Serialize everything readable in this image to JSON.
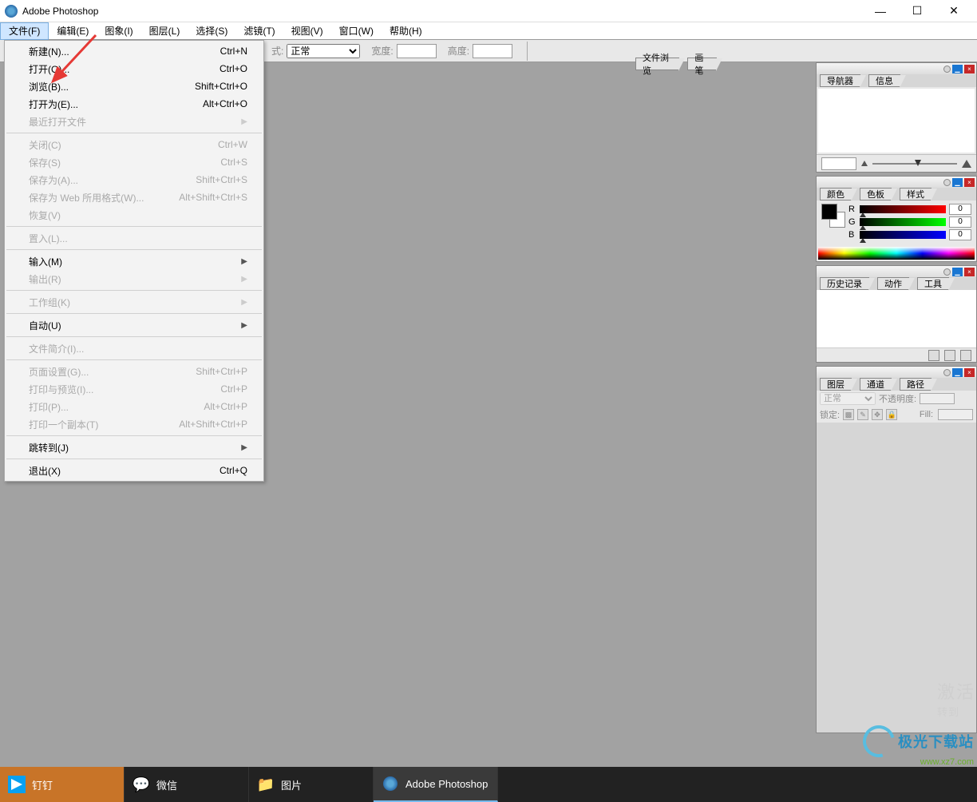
{
  "titlebar": {
    "title": "Adobe Photoshop"
  },
  "menubar": {
    "items": [
      "文件(F)",
      "编辑(E)",
      "图象(I)",
      "图层(L)",
      "选择(S)",
      "滤镜(T)",
      "视图(V)",
      "窗口(W)",
      "帮助(H)"
    ]
  },
  "optionsbar": {
    "mode_label": "式:",
    "mode_value": "正常",
    "width_label": "宽度:",
    "height_label": "高度:",
    "palette_tabs": [
      "文件浏览",
      "画笔"
    ]
  },
  "file_menu": {
    "items": [
      {
        "label": "新建(N)...",
        "shortcut": "Ctrl+N",
        "enabled": true
      },
      {
        "label": "打开(O)...",
        "shortcut": "Ctrl+O",
        "enabled": true
      },
      {
        "label": "浏览(B)...",
        "shortcut": "Shift+Ctrl+O",
        "enabled": true
      },
      {
        "label": "打开为(E)...",
        "shortcut": "Alt+Ctrl+O",
        "enabled": true
      },
      {
        "label": "最近打开文件",
        "shortcut": "",
        "enabled": false,
        "submenu": true
      },
      {
        "sep": true
      },
      {
        "label": "关闭(C)",
        "shortcut": "Ctrl+W",
        "enabled": false
      },
      {
        "label": "保存(S)",
        "shortcut": "Ctrl+S",
        "enabled": false
      },
      {
        "label": "保存为(A)...",
        "shortcut": "Shift+Ctrl+S",
        "enabled": false
      },
      {
        "label": "保存为 Web 所用格式(W)...",
        "shortcut": "Alt+Shift+Ctrl+S",
        "enabled": false
      },
      {
        "label": "恢复(V)",
        "shortcut": "",
        "enabled": false
      },
      {
        "sep": true
      },
      {
        "label": "置入(L)...",
        "shortcut": "",
        "enabled": false
      },
      {
        "sep": true
      },
      {
        "label": "输入(M)",
        "shortcut": "",
        "enabled": true,
        "submenu": true
      },
      {
        "label": "输出(R)",
        "shortcut": "",
        "enabled": false,
        "submenu": true
      },
      {
        "sep": true
      },
      {
        "label": "工作组(K)",
        "shortcut": "",
        "enabled": false,
        "submenu": true
      },
      {
        "sep": true
      },
      {
        "label": "自动(U)",
        "shortcut": "",
        "enabled": true,
        "submenu": true
      },
      {
        "sep": true
      },
      {
        "label": "文件简介(I)...",
        "shortcut": "",
        "enabled": false
      },
      {
        "sep": true
      },
      {
        "label": "页面设置(G)...",
        "shortcut": "Shift+Ctrl+P",
        "enabled": false
      },
      {
        "label": "打印与预览(I)...",
        "shortcut": "Ctrl+P",
        "enabled": false
      },
      {
        "label": "打印(P)...",
        "shortcut": "Alt+Ctrl+P",
        "enabled": false
      },
      {
        "label": "打印一个副本(T)",
        "shortcut": "Alt+Shift+Ctrl+P",
        "enabled": false
      },
      {
        "sep": true
      },
      {
        "label": "跳转到(J)",
        "shortcut": "",
        "enabled": true,
        "submenu": true
      },
      {
        "sep": true
      },
      {
        "label": "退出(X)",
        "shortcut": "Ctrl+Q",
        "enabled": true
      }
    ]
  },
  "panels": {
    "navigator": {
      "tabs": [
        "导航器",
        "信息"
      ]
    },
    "color": {
      "tabs": [
        "颜色",
        "色板",
        "样式"
      ],
      "channels": [
        {
          "name": "R",
          "value": "0"
        },
        {
          "name": "G",
          "value": "0"
        },
        {
          "name": "B",
          "value": "0"
        }
      ]
    },
    "history": {
      "tabs": [
        "历史记录",
        "动作",
        "工具"
      ]
    },
    "layers": {
      "tabs": [
        "图层",
        "通道",
        "路径"
      ],
      "blend_mode": "正常",
      "opacity_label": "不透明度:",
      "lock_label": "锁定:",
      "fill_label": "Fill:"
    }
  },
  "watermark": {
    "line1": "激活",
    "line2": "转到",
    "brand": "极光下载站",
    "url": "www.xz7.com"
  },
  "taskbar": {
    "items": [
      {
        "label": "钉钉",
        "icon": "dingtalk"
      },
      {
        "label": "微信",
        "icon": "wechat"
      },
      {
        "label": "图片",
        "icon": "folder"
      },
      {
        "label": "Adobe Photoshop",
        "icon": "photoshop"
      }
    ]
  }
}
